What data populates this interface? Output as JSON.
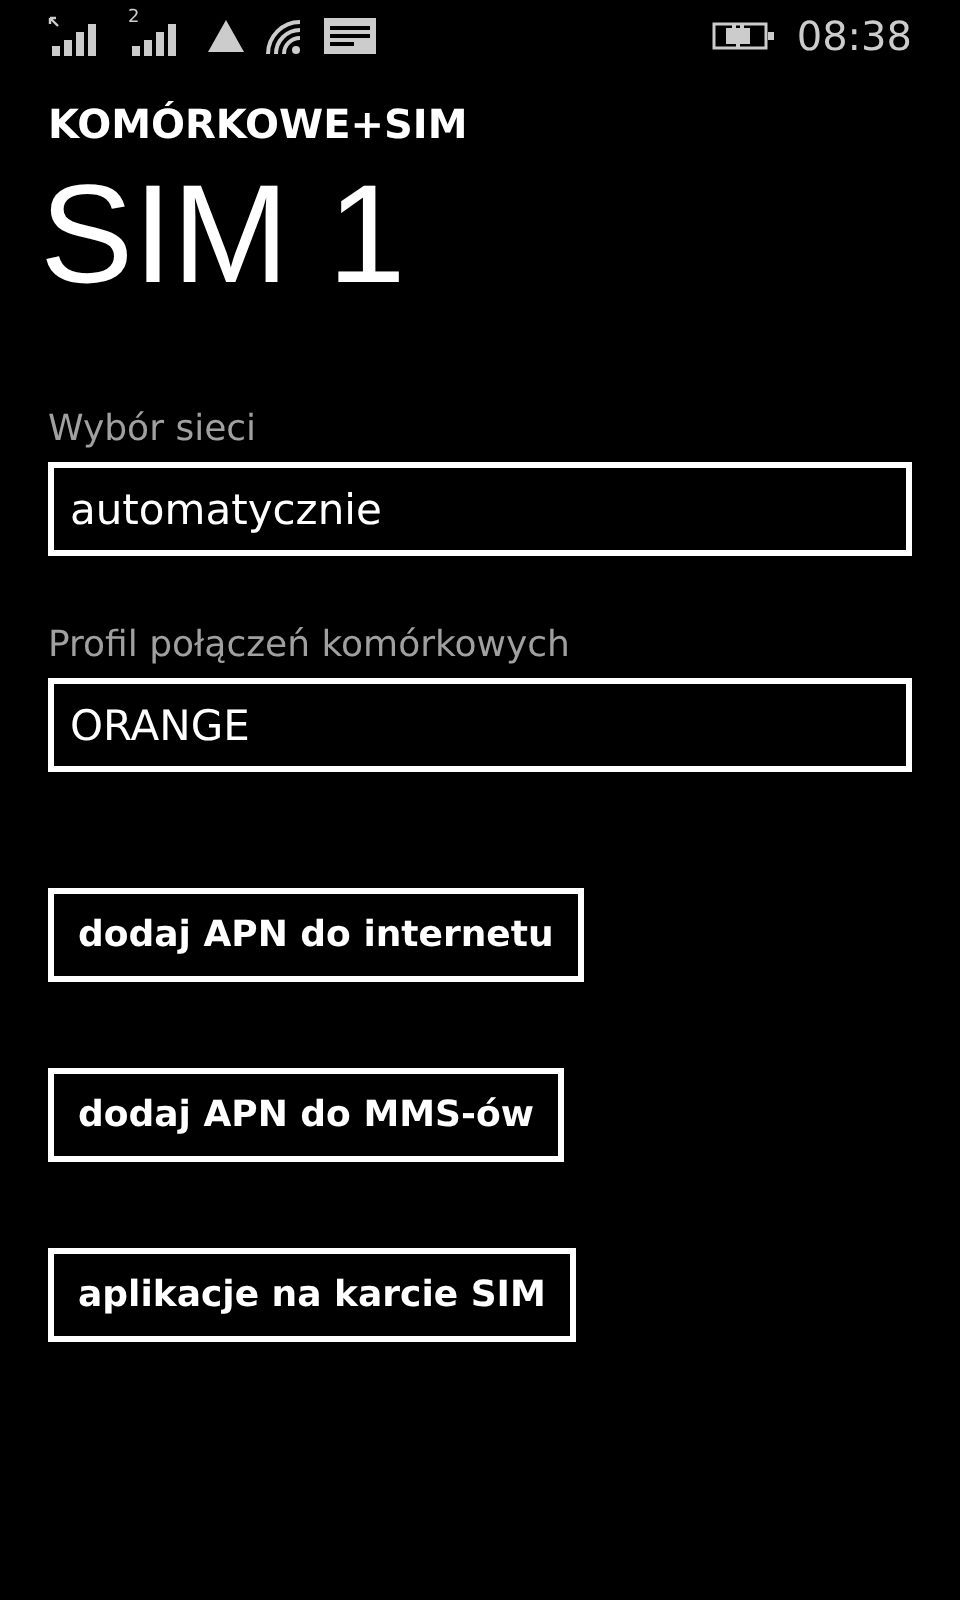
{
  "status_bar": {
    "sim2_label": "2",
    "time": "08:38"
  },
  "header": {
    "app_title": "KOMÓRKOWE+SIM",
    "page_title": "SIM 1"
  },
  "fields": [
    {
      "label": "Wybór sieci",
      "value": "automatycznie"
    },
    {
      "label": "Profil połączeń komórkowych",
      "value": "ORANGE"
    }
  ],
  "buttons": [
    "dodaj APN do internetu",
    "dodaj APN do MMS-ów",
    "aplikacje na karcie SIM"
  ]
}
